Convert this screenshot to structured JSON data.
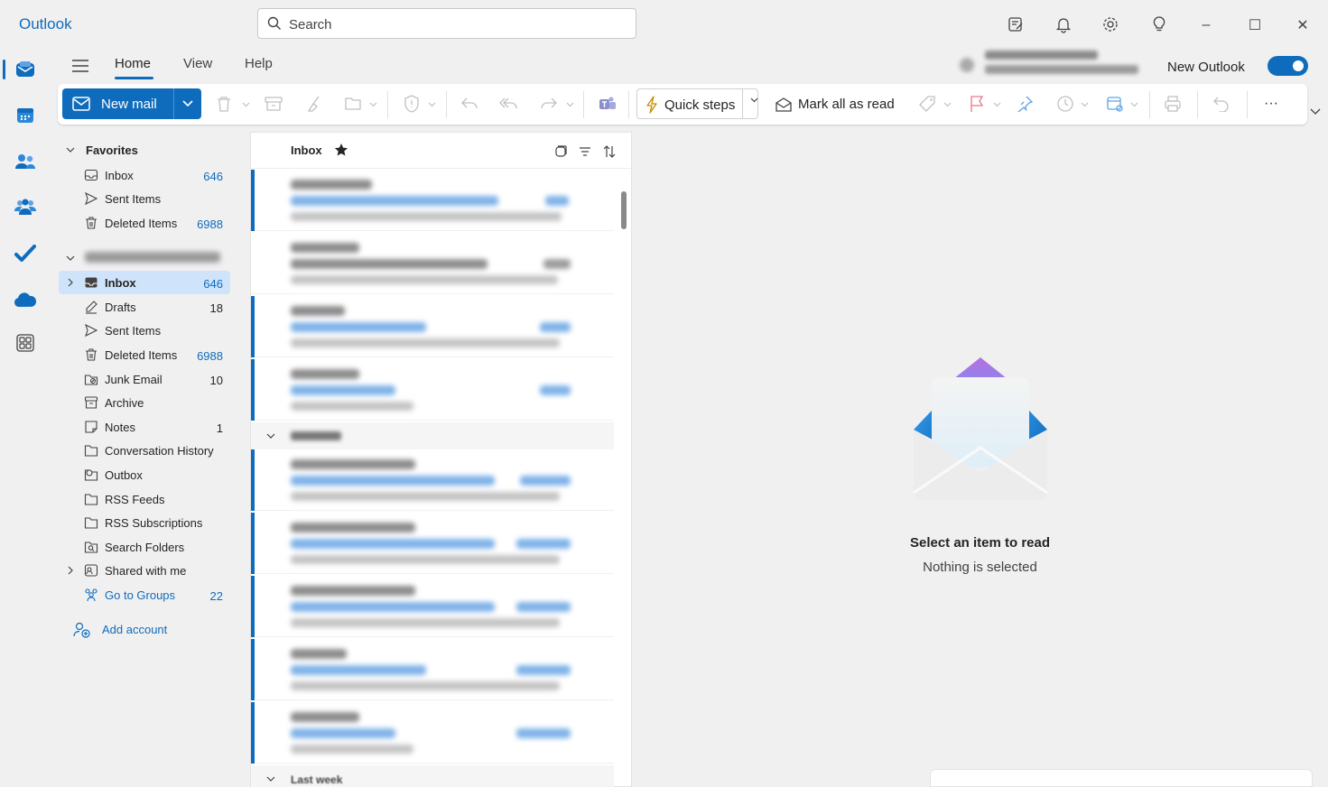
{
  "app": {
    "title": "Outlook"
  },
  "search": {
    "placeholder": "Search"
  },
  "titlebar_icons": [
    "my-day-icon",
    "bell-icon",
    "gear-icon",
    "lightbulb-icon"
  ],
  "window_controls": {
    "minimize": "–",
    "maximize": "☐",
    "close": "✕"
  },
  "ribbon_tabs": [
    {
      "label": "Home",
      "active": true
    },
    {
      "label": "View",
      "active": false
    },
    {
      "label": "Help",
      "active": false
    }
  ],
  "new_outlook": {
    "label": "New Outlook",
    "enabled": true
  },
  "ribbon": {
    "new_mail_label": "New mail",
    "quick_steps_label": "Quick steps",
    "mark_all_read_label": "Mark all as read",
    "more_label": "···"
  },
  "folders": {
    "favorites_header": "Favorites",
    "favorites": [
      {
        "label": "Inbox",
        "count": "646",
        "icon": "inbox-icon"
      },
      {
        "label": "Sent Items",
        "count": "",
        "icon": "send-icon"
      },
      {
        "label": "Deleted Items",
        "count": "6988",
        "icon": "trash-icon"
      }
    ],
    "account_items": [
      {
        "label": "Inbox",
        "count": "646",
        "icon": "inbox-icon",
        "selected": true
      },
      {
        "label": "Drafts",
        "count": "18",
        "icon": "drafts-icon"
      },
      {
        "label": "Sent Items",
        "count": "",
        "icon": "send-icon"
      },
      {
        "label": "Deleted Items",
        "count": "6988",
        "icon": "trash-icon"
      },
      {
        "label": "Junk Email",
        "count": "10",
        "icon": "junk-icon"
      },
      {
        "label": "Archive",
        "count": "",
        "icon": "archive-icon"
      },
      {
        "label": "Notes",
        "count": "1",
        "icon": "note-icon"
      },
      {
        "label": "Conversation History",
        "count": "",
        "icon": "folder-icon"
      },
      {
        "label": "Outbox",
        "count": "",
        "icon": "outbox-icon"
      },
      {
        "label": "RSS Feeds",
        "count": "",
        "icon": "folder-icon"
      },
      {
        "label": "RSS Subscriptions",
        "count": "",
        "icon": "folder-icon"
      },
      {
        "label": "Search Folders",
        "count": "",
        "icon": "search-folder-icon"
      },
      {
        "label": "Shared with me",
        "count": "",
        "icon": "shared-icon"
      },
      {
        "label": "Go to Groups",
        "count": "22",
        "icon": "groups-icon"
      }
    ],
    "add_account_label": "Add account"
  },
  "message_list": {
    "title": "Inbox",
    "group_last_week": "Last week"
  },
  "reading_pane": {
    "title": "Select an item to read",
    "subtitle": "Nothing is selected"
  },
  "colors": {
    "accent": "#0f6cbd",
    "selected_bg": "#cfe4fa"
  }
}
